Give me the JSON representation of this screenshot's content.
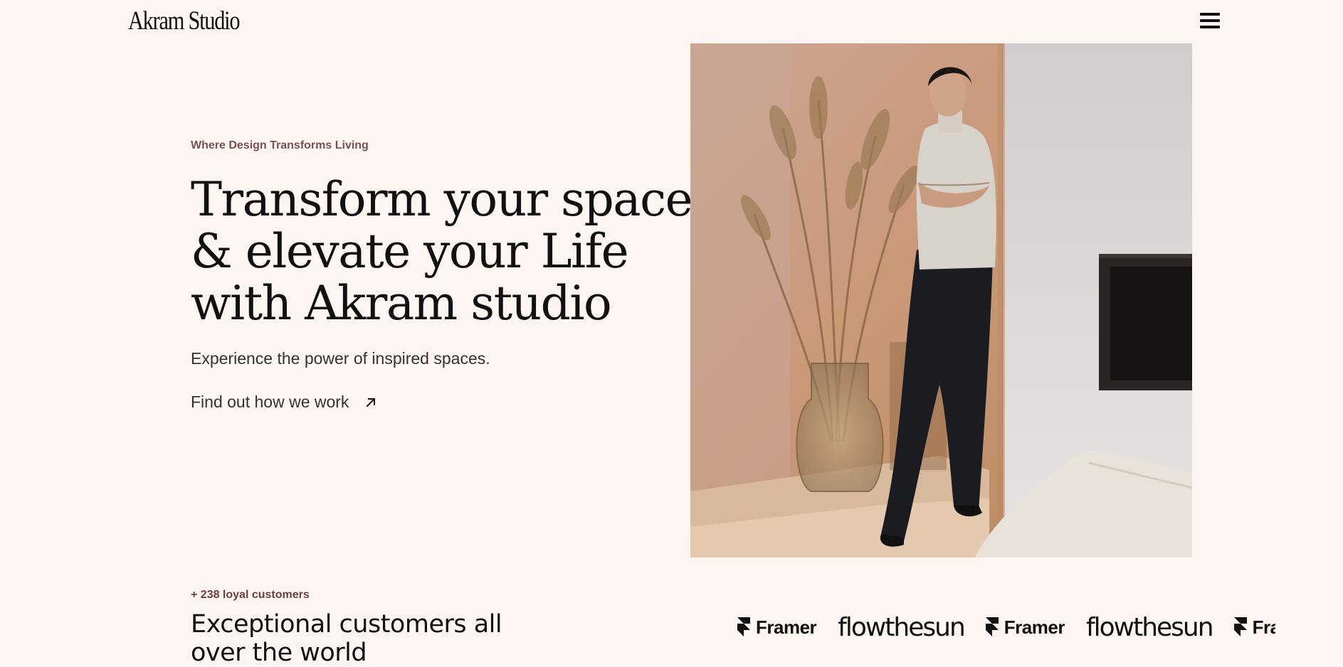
{
  "header": {
    "logo": "Akram Studio",
    "menu_icon": "hamburger-menu-icon"
  },
  "hero": {
    "eyebrow": "Where Design Transforms Living",
    "title_lines": [
      "Transform your space",
      "& elevate your Life",
      "with Akram studio"
    ],
    "subtitle": "Experience the power of inspired spaces.",
    "cta_label": "Find out how we work",
    "cta_icon": "arrow-up-right-icon",
    "image": "woman-standing-in-interior-photo"
  },
  "customers": {
    "count_label": "+ 238 loyal customers",
    "title_lines": [
      "Exceptional customers all",
      "over the world"
    ],
    "logos": [
      {
        "name": "Framer",
        "icon": "framer-logo-icon"
      },
      {
        "name": "flowthesun"
      },
      {
        "name": "Framer",
        "icon": "framer-logo-icon"
      },
      {
        "name": "flowthesun"
      },
      {
        "name": "Framer",
        "icon": "framer-logo-icon"
      }
    ]
  },
  "colors": {
    "background": "#fcf5f1",
    "accent_text": "#6b3e3e",
    "text": "#111111"
  }
}
